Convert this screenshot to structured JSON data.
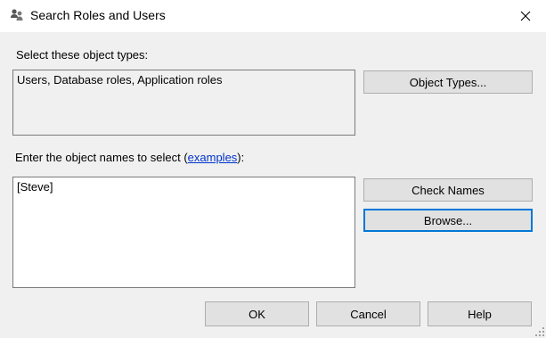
{
  "window": {
    "title": "Search Roles and Users",
    "icon": "users-group-icon",
    "close_icon": "close-icon"
  },
  "object_types": {
    "label": "Select these object types:",
    "value": "Users, Database roles, Application roles",
    "button": "Object Types..."
  },
  "object_names": {
    "label_prefix": "Enter the object names to select (",
    "link": "examples",
    "label_suffix": "):",
    "value": "[Steve]",
    "check_button": "Check Names",
    "browse_button": "Browse..."
  },
  "footer": {
    "ok": "OK",
    "cancel": "Cancel",
    "help": "Help"
  },
  "colors": {
    "focus_border": "#0078d7",
    "link": "#0033cc",
    "button_bg": "#e1e1e1"
  }
}
